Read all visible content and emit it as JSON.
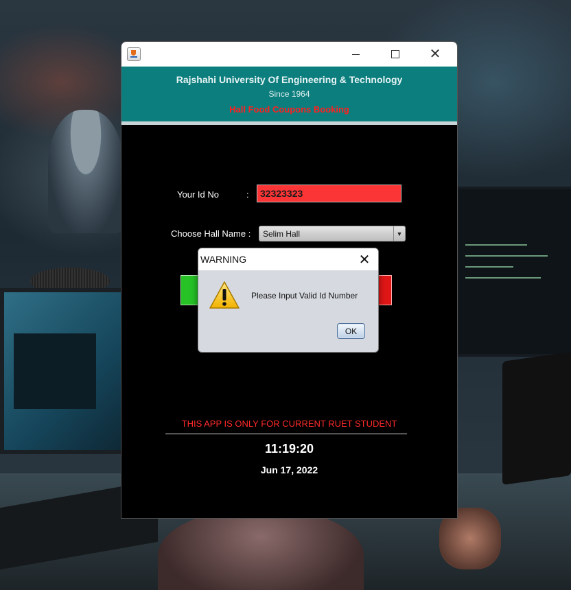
{
  "window": {
    "university_name": "Rajshahi University Of Engineering & Technology",
    "since": "Since 1964",
    "subtitle": "Hall Food Coupons Booking",
    "id_label": "Your Id No",
    "id_colon": ":",
    "id_value": "32323323",
    "hall_label": "Choose Hall Name :",
    "hall_selected": "Selim Hall",
    "footer_note": "THIS APP IS ONLY FOR CURRENT RUET STUDENT",
    "time": "11:19:20",
    "date": "Jun 17, 2022"
  },
  "dialog": {
    "title": "WARNING",
    "message": "Please Input Valid Id Number",
    "ok_label": "OK",
    "icon": "warning-icon"
  },
  "colors": {
    "header_teal": "#0d7e7e",
    "subtitle_red": "#ff2020",
    "input_red": "#fb3535",
    "green_button": "#26c226",
    "red_button": "#e01616"
  }
}
